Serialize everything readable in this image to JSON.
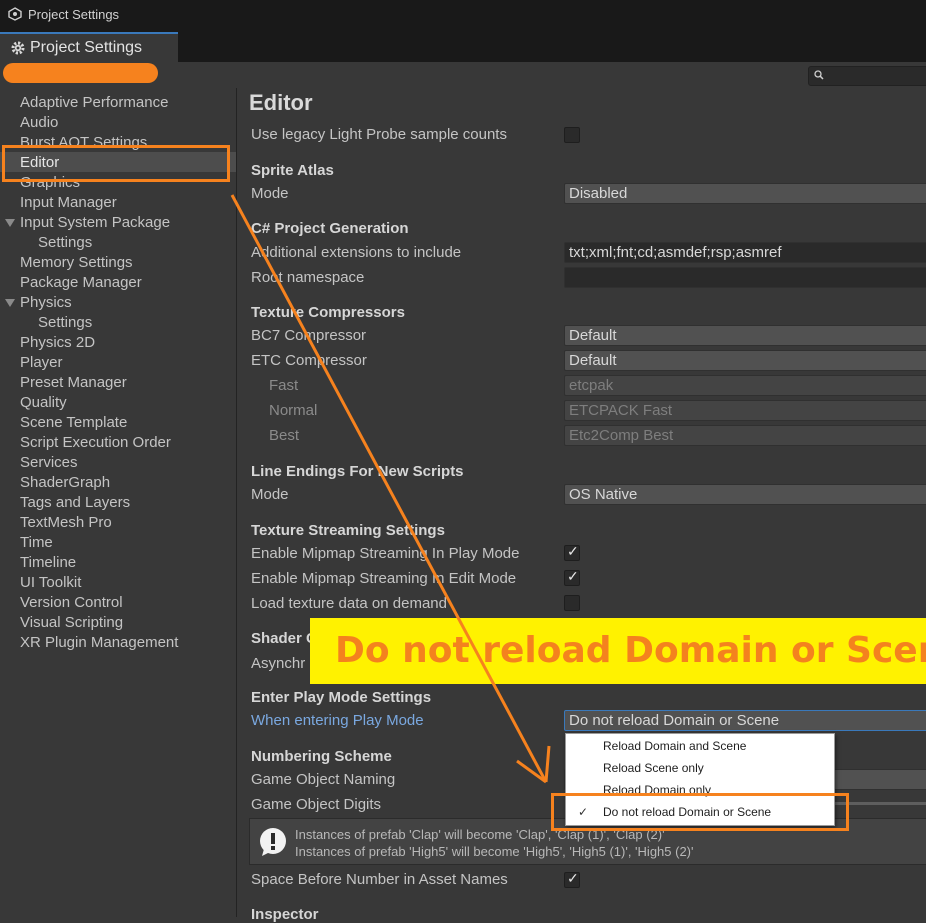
{
  "window": {
    "title": "Project Settings",
    "tab_label": "Project Settings"
  },
  "search": {
    "placeholder": ""
  },
  "sidebar": {
    "items": [
      {
        "label": "Adaptive Performance"
      },
      {
        "label": "Audio"
      },
      {
        "label": "Burst AOT Settings"
      },
      {
        "label": "Editor"
      },
      {
        "label": "Graphics"
      },
      {
        "label": "Input Manager"
      },
      {
        "label": "Input System Package"
      },
      {
        "label": "Settings"
      },
      {
        "label": "Memory Settings"
      },
      {
        "label": "Package Manager"
      },
      {
        "label": "Physics"
      },
      {
        "label": "Settings"
      },
      {
        "label": "Physics 2D"
      },
      {
        "label": "Player"
      },
      {
        "label": "Preset Manager"
      },
      {
        "label": "Quality"
      },
      {
        "label": "Scene Template"
      },
      {
        "label": "Script Execution Order"
      },
      {
        "label": "Services"
      },
      {
        "label": "ShaderGraph"
      },
      {
        "label": "Tags and Layers"
      },
      {
        "label": "TextMesh Pro"
      },
      {
        "label": "Time"
      },
      {
        "label": "Timeline"
      },
      {
        "label": "UI Toolkit"
      },
      {
        "label": "Version Control"
      },
      {
        "label": "Visual Scripting"
      },
      {
        "label": "XR Plugin Management"
      }
    ]
  },
  "main": {
    "title": "Editor",
    "legacy_light_probe": "Use legacy Light Probe sample counts",
    "sprite_atlas": {
      "header": "Sprite Atlas",
      "mode_label": "Mode",
      "mode_value": "Disabled"
    },
    "csharp": {
      "header": "C# Project Generation",
      "ext_label": "Additional extensions to include",
      "ext_value": "txt;xml;fnt;cd;asmdef;rsp;asmref",
      "ns_label": "Root namespace",
      "ns_value": ""
    },
    "texture_compressors": {
      "header": "Texture Compressors",
      "bc7_label": "BC7 Compressor",
      "bc7_value": "Default",
      "etc_label": "ETC Compressor",
      "etc_value": "Default",
      "fast_label": "Fast",
      "fast_value": "etcpak",
      "normal_label": "Normal",
      "normal_value": "ETCPACK Fast",
      "best_label": "Best",
      "best_value": "Etc2Comp Best"
    },
    "line_endings": {
      "header": "Line Endings For New Scripts",
      "mode_label": "Mode",
      "mode_value": "OS Native"
    },
    "texture_streaming": {
      "header": "Texture Streaming Settings",
      "play_label": "Enable Mipmap Streaming In Play Mode",
      "edit_label": "Enable Mipmap Streaming In Edit Mode",
      "load_label": "Load texture data on demand"
    },
    "shader": {
      "header": "Shader C",
      "async_label": "Asynchr"
    },
    "play_mode": {
      "header": "Enter Play Mode Settings",
      "when_label": "When entering Play Mode",
      "when_value": "Do not reload Domain or Scene"
    },
    "numbering": {
      "header": "Numbering Scheme",
      "naming_label": "Game Object Naming",
      "digits_label": "Game Object Digits",
      "help_line1": "Instances of prefab 'Clap' will become 'Clap', 'Clap (1)', 'Clap (2)'",
      "help_line2": "Instances of prefab 'High5' will become 'High5', 'High5 (1)', 'High5 (2)'",
      "space_label": "Space Before Number in Asset Names"
    },
    "inspector_header": "Inspector"
  },
  "dropdown": {
    "options": [
      {
        "label": "Reload Domain and Scene"
      },
      {
        "label": "Reload Scene only"
      },
      {
        "label": "Reload Domain only"
      },
      {
        "label": "Do not reload Domain or Scene"
      }
    ],
    "check_mark": "✓"
  },
  "annotation": {
    "banner_text": "Do not reload Domain or Scene",
    "color": "#f6821e",
    "banner_bg": "#fff200"
  }
}
